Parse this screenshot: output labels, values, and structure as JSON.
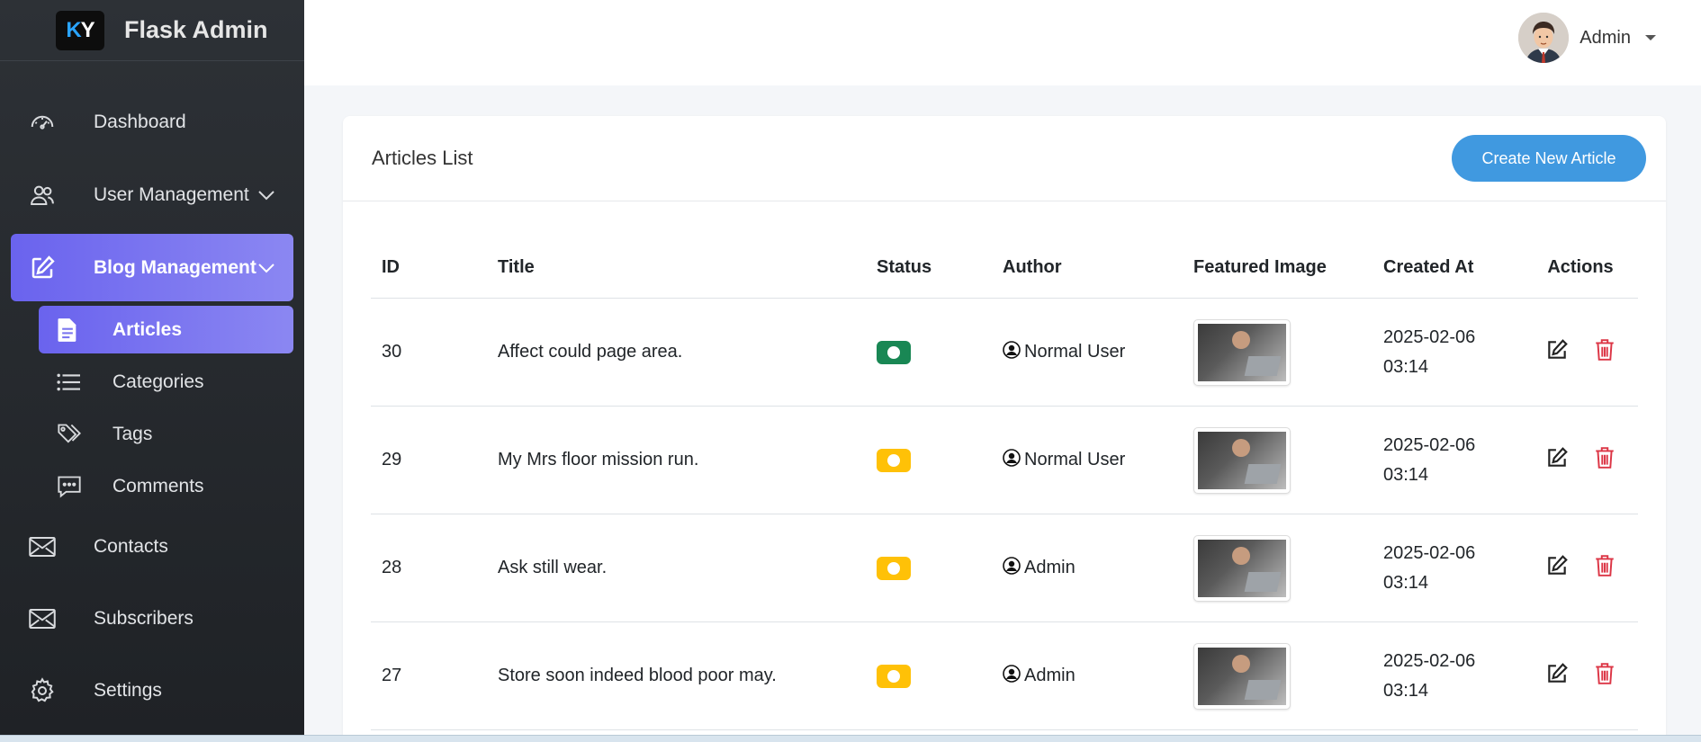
{
  "brand": {
    "logo_k": "K",
    "logo_y": "Y",
    "name": "Flask Admin"
  },
  "sidebar": {
    "items": [
      {
        "label": "Dashboard",
        "icon": "dashboard-icon"
      },
      {
        "label": "User Management",
        "icon": "users-icon"
      },
      {
        "label": "Blog Management",
        "icon": "edit-icon"
      },
      {
        "label": "Contacts",
        "icon": "envelope-icon"
      },
      {
        "label": "Subscribers",
        "icon": "envelope-icon"
      },
      {
        "label": "Settings",
        "icon": "gear-icon"
      }
    ],
    "blog_sub": [
      {
        "label": "Articles",
        "icon": "file-icon"
      },
      {
        "label": "Categories",
        "icon": "list-icon"
      },
      {
        "label": "Tags",
        "icon": "tags-icon"
      },
      {
        "label": "Comments",
        "icon": "comment-icon"
      }
    ]
  },
  "topbar": {
    "user_name": "Admin"
  },
  "card": {
    "title": "Articles List",
    "create_label": "Create New Article"
  },
  "table": {
    "headers": {
      "id": "ID",
      "title": "Title",
      "status": "Status",
      "author": "Author",
      "image": "Featured Image",
      "created": "Created At",
      "actions": "Actions"
    },
    "rows": [
      {
        "id": "30",
        "title": "Affect could page area.",
        "status_color": "#198754",
        "author": "Normal User",
        "date": "2025-02-06",
        "time": "03:14"
      },
      {
        "id": "29",
        "title": "My Mrs floor mission run.",
        "status_color": "#ffc107",
        "author": "Normal User",
        "date": "2025-02-06",
        "time": "03:14"
      },
      {
        "id": "28",
        "title": "Ask still wear.",
        "status_color": "#ffc107",
        "author": "Admin",
        "date": "2025-02-06",
        "time": "03:14"
      },
      {
        "id": "27",
        "title": "Store soon indeed blood poor may.",
        "status_color": "#ffc107",
        "author": "Admin",
        "date": "2025-02-06",
        "time": "03:14"
      }
    ]
  },
  "colors": {
    "accent": "#4099e0",
    "active_nav": "#6a63ee",
    "delete": "#dc3545"
  }
}
